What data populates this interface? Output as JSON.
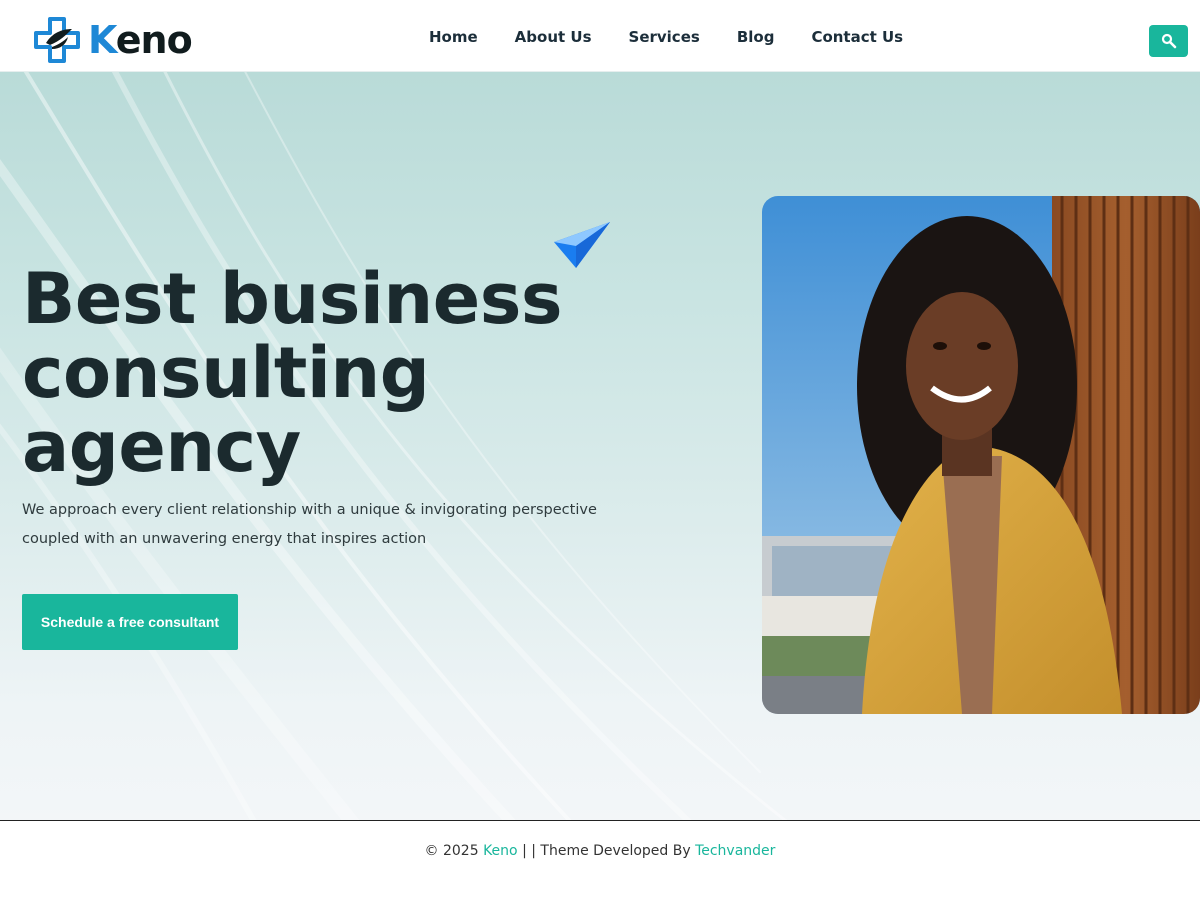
{
  "brand": {
    "logo_text_first": "K",
    "logo_text_rest": "eno",
    "primary_color": "#1e88d6",
    "accent_color": "#19b69c"
  },
  "nav": {
    "items": [
      {
        "label": "Home"
      },
      {
        "label": "About Us"
      },
      {
        "label": "Services"
      },
      {
        "label": "Blog"
      },
      {
        "label": "Contact Us"
      }
    ],
    "search_icon": "search-icon"
  },
  "hero": {
    "headline_line1": "Best business",
    "headline_line2": "consulting",
    "headline_line3": "agency",
    "subtext_line1": "We approach every client relationship with a unique & invigorating perspective",
    "subtext_line2": "coupled with an unwavering energy that inspires action",
    "cta_label": "Schedule a free consultant",
    "decor_icon": "paper-plane-icon"
  },
  "footer": {
    "copyright": "© 2025 ",
    "brand_link": "Keno",
    "separator": " | | Theme Developed By ",
    "developer_link": "Techvander"
  }
}
